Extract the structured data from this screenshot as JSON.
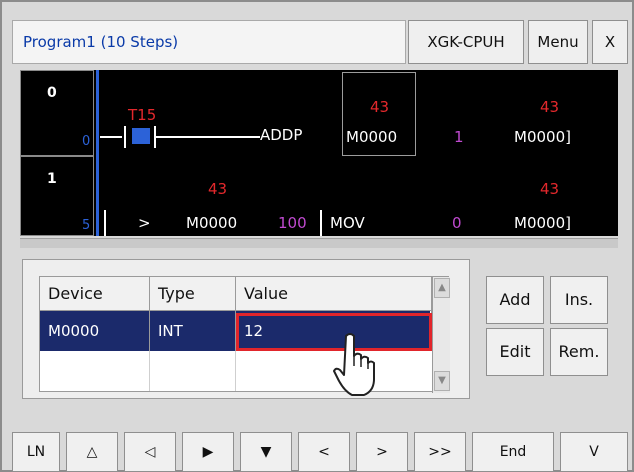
{
  "titlebar": {
    "title": "Program1 (10 Steps)",
    "cpu_label": "XGK-CPUH",
    "menu_label": "Menu",
    "close_label": "X"
  },
  "ladder": {
    "rungs": [
      {
        "number": "0",
        "step": "0",
        "contact_label": "T15",
        "instruction": "ADDP",
        "operand1": "M0000",
        "operand1_value": "43",
        "operand2": "1",
        "operand3": "M0000]",
        "operand3_value": "43"
      },
      {
        "number": "1",
        "step": "5",
        "compare_op": ">",
        "compare_operand": "M0000",
        "compare_operand_value": "43",
        "compare_const": "100",
        "instruction": "MOV",
        "operand1": "0",
        "operand2": "M0000]",
        "operand2_value": "43"
      }
    ]
  },
  "device_table": {
    "headers": [
      "Device",
      "Type",
      "Value"
    ],
    "rows": [
      {
        "device": "M0000",
        "type": "INT",
        "value": "12"
      }
    ]
  },
  "actions": {
    "add": "Add",
    "ins": "Ins.",
    "edit": "Edit",
    "rem": "Rem."
  },
  "toolbar": {
    "ln": "LN",
    "up_hollow": "△",
    "left_hollow": "◁",
    "right_solid": "▶",
    "down_solid": "▼",
    "lt": "<",
    "gt": ">",
    "dbl_gt": ">>",
    "end": "End",
    "v": "V"
  },
  "colors": {
    "accent_blue": "#0a3aa8",
    "selection": "#1b2a6b",
    "highlight_red": "#e1252b",
    "ladder_bg": "#000000",
    "rail_blue": "#2c62d8"
  }
}
